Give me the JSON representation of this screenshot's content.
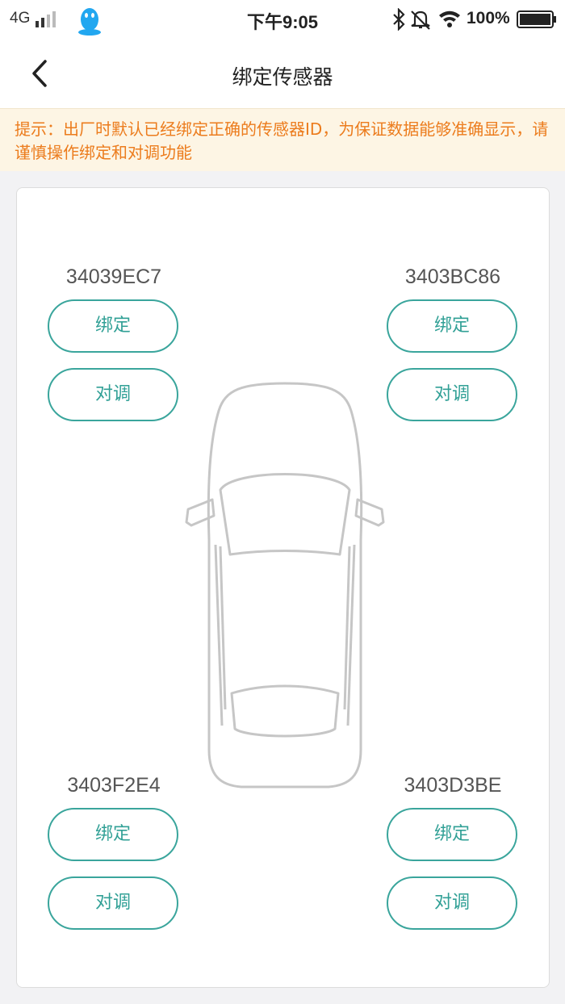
{
  "status_bar": {
    "network": "4G",
    "time": "下午9:05",
    "battery_percent": "100%",
    "icons": [
      "signal-bars-icon",
      "qq-penguin-icon",
      "bluetooth-icon",
      "notifications-off-icon",
      "wifi-icon",
      "battery-icon"
    ]
  },
  "nav": {
    "title": "绑定传感器",
    "back_icon": "chevron-left-icon"
  },
  "notice": {
    "text": "提示：出厂时默认已经绑定正确的传感器ID，为保证数据能够准确显示，请谨慎操作绑定和对调功能"
  },
  "sensors": [
    {
      "position": "front-left",
      "id": "34039EC7",
      "bind_label": "绑定",
      "swap_label": "对调"
    },
    {
      "position": "front-right",
      "id": "3403BC86",
      "bind_label": "绑定",
      "swap_label": "对调"
    },
    {
      "position": "rear-left",
      "id": "3403F2E4",
      "bind_label": "绑定",
      "swap_label": "对调"
    },
    {
      "position": "rear-right",
      "id": "3403D3BE",
      "bind_label": "绑定",
      "swap_label": "对调"
    }
  ],
  "colors": {
    "accent": "#3aa59c",
    "notice_text": "#ec7c1d",
    "notice_bg": "#fdf5e4",
    "page_bg": "#f2f2f4"
  }
}
